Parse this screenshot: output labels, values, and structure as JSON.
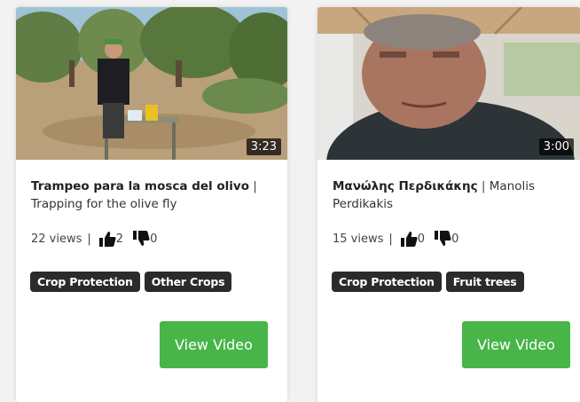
{
  "cards": [
    {
      "duration": "3:23",
      "title_main": "Trampeo para la mosca del olivo",
      "title_sep": " | ",
      "title_sub": "Trapping for the olive fly",
      "views": "22 views",
      "likes": "2",
      "dislikes": "0",
      "tags": [
        "Crop Protection",
        "Other Crops"
      ],
      "button": "View Video"
    },
    {
      "duration": "3:00",
      "title_main": "Μανώλης Περδικάκης",
      "title_sep": " | ",
      "title_sub": "Manolis Perdikakis",
      "views": "15 views",
      "likes": "0",
      "dislikes": "0",
      "tags": [
        "Crop Protection",
        "Fruit trees"
      ],
      "button": "View Video"
    }
  ],
  "colors": {
    "button_green": "#47b548",
    "tag_bg": "#2b2b2b"
  },
  "icons": [
    "thumbs-up-icon",
    "thumbs-down-icon"
  ]
}
